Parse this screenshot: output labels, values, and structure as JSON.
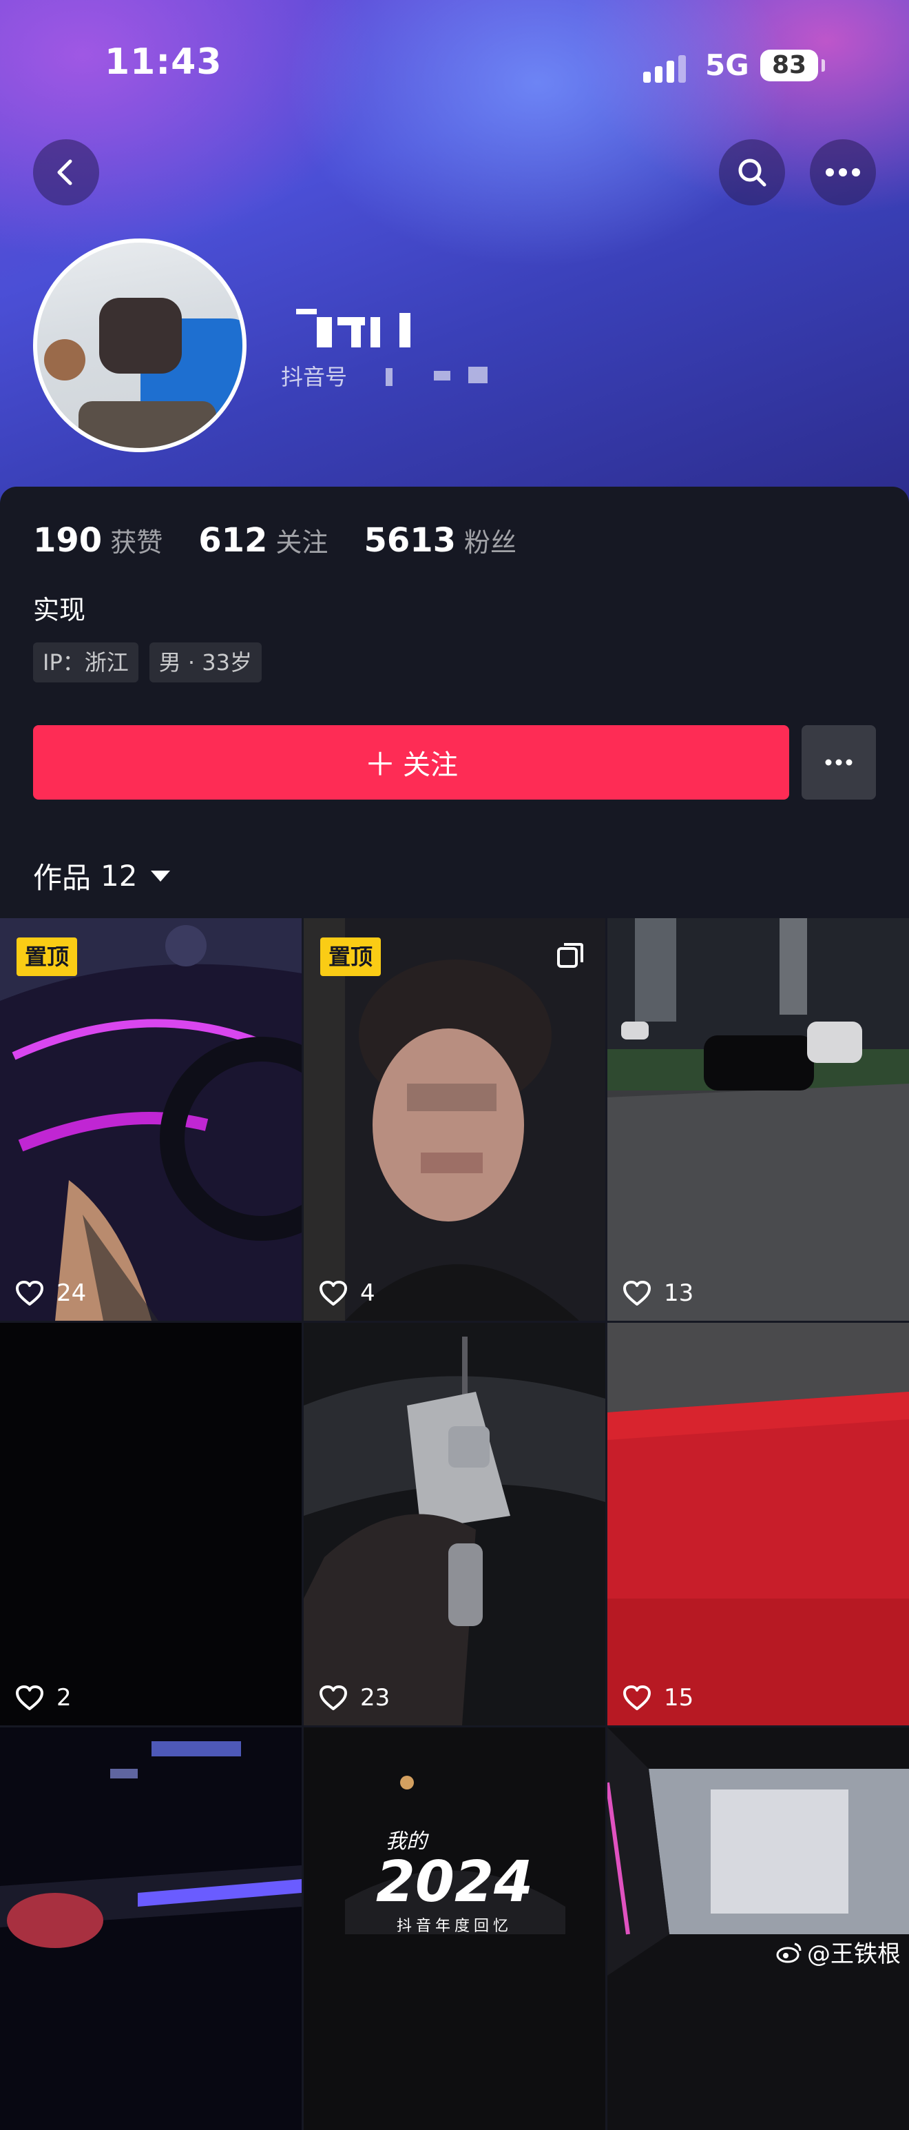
{
  "status": {
    "time": "11:43",
    "network": "5G",
    "battery": "83"
  },
  "profile": {
    "douyin_label": "抖音号",
    "stats": [
      {
        "value": "190",
        "label": "获赞"
      },
      {
        "value": "612",
        "label": "关注"
      },
      {
        "value": "5613",
        "label": "粉丝"
      }
    ],
    "bio": "实现",
    "tags": [
      "IP：浙江",
      "男 · 33岁"
    ],
    "follow_label": "关注"
  },
  "works": {
    "label": "作品",
    "count": "12",
    "pinned_label": "置顶",
    "items": [
      {
        "likes": "24"
      },
      {
        "likes": "4"
      },
      {
        "likes": "13"
      },
      {
        "likes": "2"
      },
      {
        "likes": "23"
      },
      {
        "likes": "15"
      },
      {
        "likes": ""
      },
      {
        "likes": ""
      },
      {
        "likes": ""
      }
    ],
    "year_overlay": "2024",
    "year_sub": "抖音年度回忆",
    "year_top": "我的"
  },
  "watermark": "@王铁根",
  "colors": {
    "accent": "#fe2c55",
    "pin": "#facc15",
    "background": "#161823"
  }
}
